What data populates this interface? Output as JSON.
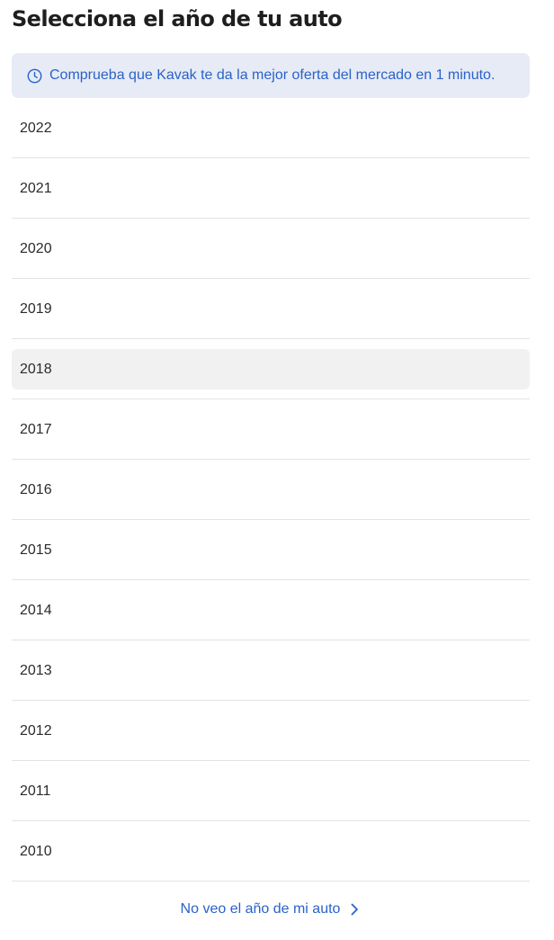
{
  "header": {
    "title": "Selecciona el año de tu auto"
  },
  "banner": {
    "icon": "clock-icon",
    "text": "Comprueba que Kavak te da la mejor oferta del mercado en 1 minuto.",
    "accent_color": "#2a62c9",
    "background_color": "#e6ebf6"
  },
  "years": {
    "selected": "2018",
    "items": [
      {
        "label": "2022"
      },
      {
        "label": "2021"
      },
      {
        "label": "2020"
      },
      {
        "label": "2019"
      },
      {
        "label": "2018"
      },
      {
        "label": "2017"
      },
      {
        "label": "2016"
      },
      {
        "label": "2015"
      },
      {
        "label": "2014"
      },
      {
        "label": "2013"
      },
      {
        "label": "2012"
      },
      {
        "label": "2011"
      },
      {
        "label": "2010"
      }
    ]
  },
  "footer": {
    "link_label": "No veo el año de mi auto",
    "icon": "chevron-right-icon"
  }
}
